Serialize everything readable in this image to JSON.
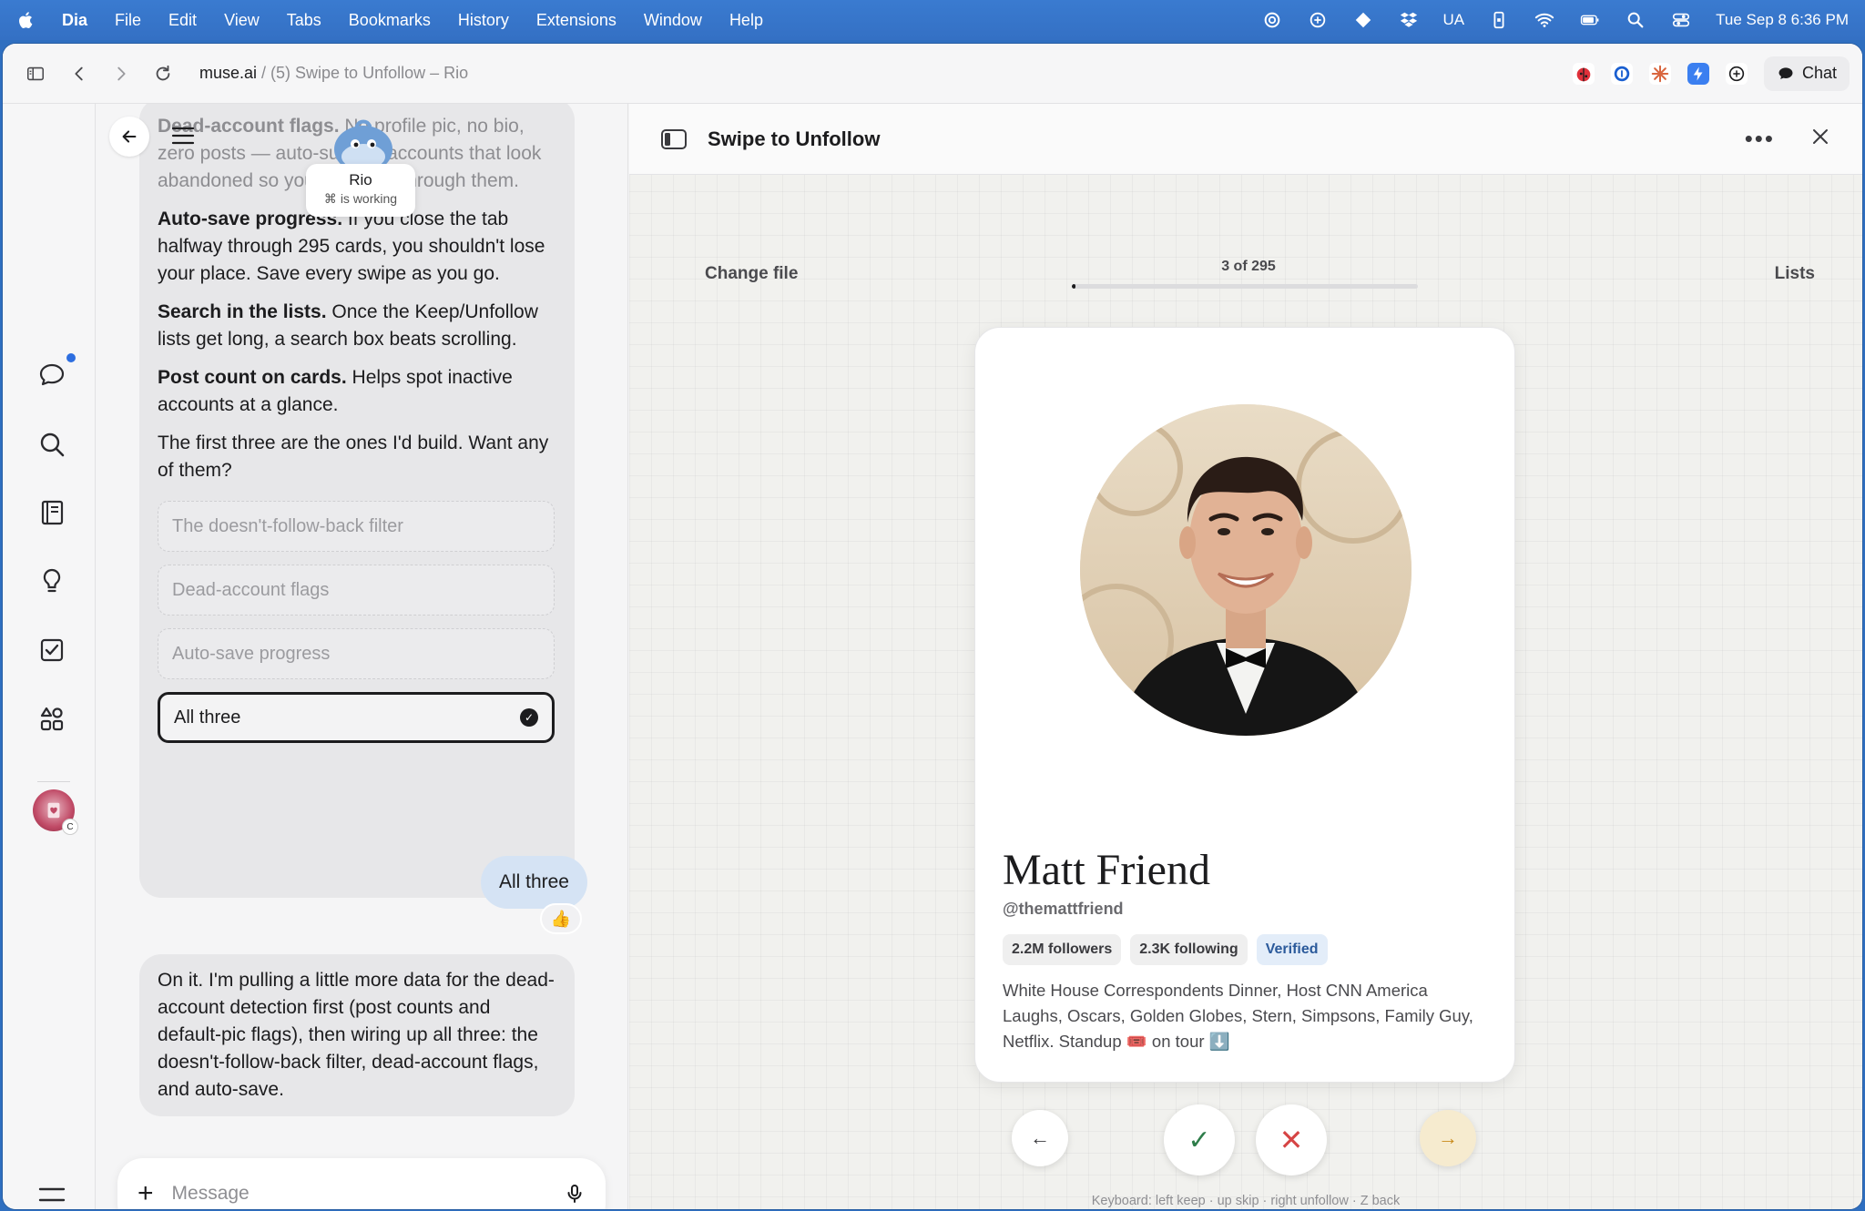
{
  "menubar": {
    "app": "Dia",
    "items": [
      "File",
      "Edit",
      "View",
      "Tabs",
      "Bookmarks",
      "History",
      "Extensions",
      "Window",
      "Help"
    ],
    "status_text_ua": "UA",
    "clock": "Tue Sep 8  6:36 PM"
  },
  "toolbar": {
    "url_domain": "muse.ai",
    "url_sub": " / (5) Swipe to Unfollow – Rio",
    "chat_label": "Chat"
  },
  "rail": {
    "icons": [
      "chat-icon",
      "search-icon",
      "notebook-icon",
      "lightbulb-icon",
      "checkbox-icon",
      "apps-icon"
    ]
  },
  "chat": {
    "rio": {
      "name": "Rio",
      "status": "is working"
    },
    "ai_message_1": {
      "intro_bold": "Dead-account flags.",
      "intro_text": " No profile pic, no bio, zero posts — auto-surface accounts that look abandoned so you can blow through them.",
      "p2_bold": "Auto-save progress.",
      "p2_text": " If you close the tab halfway through 295 cards, you shouldn't lose your place. Save every swipe as you go.",
      "p3_bold": "Search in the lists.",
      "p3_text": " Once the Keep/Unfollow lists get long, a search box beats scrolling.",
      "p4_bold": "Post count on cards.",
      "p4_text": " Helps spot inactive accounts at a glance.",
      "p5": "The first three are the ones I'd build. Want any of them?"
    },
    "options": [
      "The doesn't-follow-back filter",
      "Dead-account flags",
      "Auto-save progress"
    ],
    "selected_option": "All three",
    "user_message": "All three",
    "reaction": "👍",
    "ai_message_2": "On it. I'm pulling a little more data for the dead-account detection first (post counts and default-pic flags), then wiring up all three: the doesn't-follow-back filter, dead-account flags, and auto-save.",
    "composer_placeholder": "Message"
  },
  "pane": {
    "title": "Swipe to Unfollow",
    "change_file": "Change file",
    "lists": "Lists",
    "progress_text": "3 of 295",
    "progress_fraction": 0.0102,
    "profile": {
      "name": "Matt Friend",
      "handle": "@themattfriend",
      "followers": "2.2M followers",
      "following": "2.3K following",
      "verified": "Verified",
      "bio": "White House Correspondents Dinner, Host CNN America Laughs, Oscars, Golden Globes, Stern, Simpsons, Family Guy, Netflix. Standup 🎟️ on tour ⬇️"
    },
    "keyboard_hint": "Keyboard: left keep · up skip · right unfollow · Z back",
    "buttons": {
      "back": "←",
      "keep": "✓",
      "unfollow": "✕",
      "skip": "→"
    }
  }
}
